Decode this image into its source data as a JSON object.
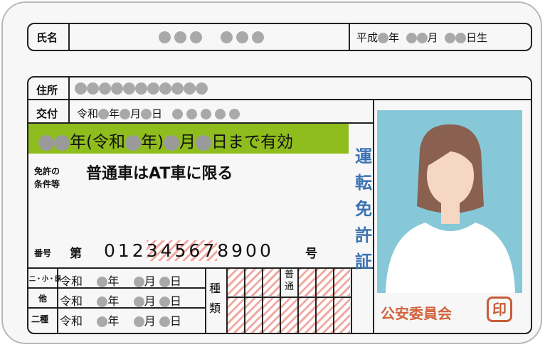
{
  "name_row": {
    "label": "氏名",
    "birth_era": "平成",
    "birth_year_unit": "年",
    "birth_month_unit": "月",
    "birth_day_unit": "日生"
  },
  "address_row": {
    "label": "住所"
  },
  "issue_row": {
    "label": "交付",
    "era": "令和",
    "year_unit": "年",
    "month_unit": "月",
    "day_unit": "日"
  },
  "validity": {
    "year_unit": "年(令和",
    "year_unit2": "年)",
    "month_unit": "月",
    "day_unit": "日まで有効"
  },
  "conditions": {
    "label_line1": "免許の",
    "label_line2": "条件等",
    "value": "普通車はAT車に限る"
  },
  "number": {
    "label": "番号",
    "prefix": "第",
    "digits_a": "012",
    "digits_b": "34567",
    "digits_c": "8900",
    "suffix": "号"
  },
  "license_history": [
    {
      "label": "二・小・原",
      "era": "令和",
      "year": "年",
      "month": "月",
      "day": "日"
    },
    {
      "label": "他",
      "era": "令和",
      "year": "年",
      "month": "月",
      "day": "日"
    },
    {
      "label": "二種",
      "era": "令和",
      "year": "年",
      "month": "月",
      "day": "日"
    }
  ],
  "kind": {
    "label_top": "種",
    "label_bottom": "類",
    "futsu_line1": "普",
    "futsu_line2": "通"
  },
  "side_title": [
    "運",
    "転",
    "免",
    "許",
    "証"
  ],
  "commission": "公安委員会",
  "seal": "印",
  "colors": {
    "validity_bg": "#8fbd1e",
    "photo_bg": "#86c8d8",
    "title_blue": "#3c73b1",
    "seal_red": "#c75c3a",
    "hatch": "#f0a9a1"
  }
}
